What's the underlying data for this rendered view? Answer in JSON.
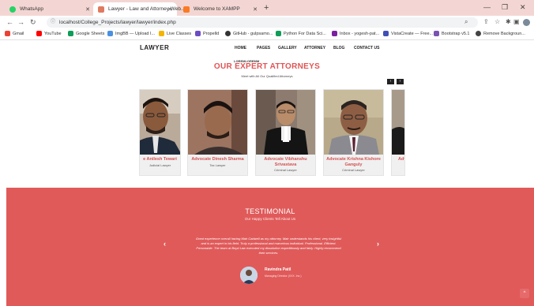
{
  "browser": {
    "tabs": [
      {
        "label": "WhatsApp",
        "color": "#25d366"
      },
      {
        "label": "Lawyer - Law and Attorney Web...",
        "color": "#e07a5f"
      },
      {
        "label": "Welcome to XAMPP",
        "color": "#fb7a24"
      }
    ],
    "new_tab": "+",
    "url": "localhost/College_Projects/lawyer/lawyer/index.php",
    "bookmarks": [
      {
        "label": "Gmail",
        "color": "#ea4335"
      },
      {
        "label": "YouTube",
        "color": "#ff0000"
      },
      {
        "label": "Google Sheets",
        "color": "#0f9d58"
      },
      {
        "label": "ImgBB — Upload I...",
        "color": "#4a90e2"
      },
      {
        "label": "Live Classes",
        "color": "#f4b400"
      },
      {
        "label": "Propelld",
        "color": "#6c4cc4"
      },
      {
        "label": "GitHub - gulpsamo...",
        "color": "#333333"
      },
      {
        "label": "Python For Data Sci...",
        "color": "#0f9d58"
      },
      {
        "label": "Inbox - yogesh-pat...",
        "color": "#7b1fa2"
      },
      {
        "label": "VistaCreate — Free...",
        "color": "#3f51b5"
      },
      {
        "label": "Bootstrap v5.1",
        "color": "#7952b3"
      },
      {
        "label": "Remove Backgroun...",
        "color": "#444444"
      }
    ]
  },
  "site": {
    "logo": "LAWYER",
    "nav": [
      "HOME",
      "PAGES",
      "GALLERY",
      "ATTORNEY",
      "BLOG",
      "CONTACT US"
    ]
  },
  "attorneys": {
    "eyebrow": "LOREMLOREMM",
    "title": "OUR EXPERT ATTORNEYS",
    "subtitle": "Meet with All Our Qualified Attorneys",
    "prev": "‹",
    "next": "›",
    "cards": [
      {
        "name": "Advocate Anilesh Tewari",
        "visible_name": "e Anilesh Tewari",
        "role": "Judicial Lawyer"
      },
      {
        "name": "Advocate Dinesh Sharma",
        "visible_name": "Advocate Dinesh Sharma",
        "role": "Tax Lawyer"
      },
      {
        "name": "Advocate Vibhanshu Srivastava",
        "visible_name": "Advocate Vibhanshu Srivastava",
        "role": "Criminal Lawyer"
      },
      {
        "name": "Advocate Krishna Kishore Ganguly",
        "visible_name": "Advocate Krishna Kishore Ganguly",
        "role": "Criminal Lawyer"
      },
      {
        "name": "Adv",
        "visible_name": "Adv",
        "role": ""
      }
    ]
  },
  "testimonial": {
    "title": "TESTIMONIAL",
    "subtitle": "Our Happy Clients Tell About Us",
    "quote": "Great experience overall having Mair Cadwell as my attorney. Mair understands his client, very insightful and is an expert in his field. Truly a professional and marvelous individual. Professional. Efficient. Personable. The team at Boyd Law executed my dissolution expeditiously and fairly. Highly recommend their services.",
    "prev": "‹",
    "next": "›",
    "client_name": "Ravindra Patil",
    "client_role": "Managing Director (XXX. Inc.)",
    "accent": "#e05a5a"
  },
  "to_top": "^"
}
